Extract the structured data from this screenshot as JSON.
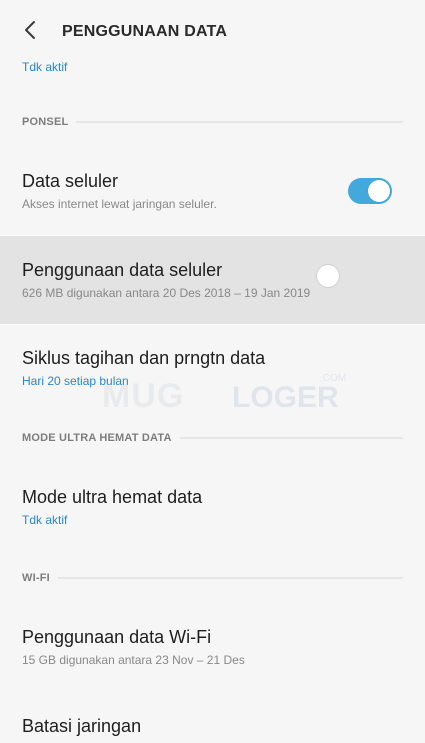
{
  "header": {
    "title": "PENGGUNAAN DATA",
    "back_icon": "chevron-left-icon"
  },
  "top_status": "Tdk aktif",
  "sections": {
    "ponsel": "PONSEL",
    "ultra": "MODE ULTRA HEMAT DATA",
    "wifi": "WI-FI"
  },
  "items": {
    "data_seluler": {
      "title": "Data seluler",
      "subtitle": "Akses internet lewat jaringan seluler.",
      "toggle_on": true
    },
    "penggunaan_seluler": {
      "title": "Penggunaan data seluler",
      "subtitle": "626 MB digunakan antara 20 Des 2018 – 19 Jan 2019"
    },
    "siklus": {
      "title": "Siklus tagihan dan prngtn data",
      "subtitle": "Hari 20 setiap bulan"
    },
    "ultra_hemat": {
      "title": "Mode ultra hemat data",
      "subtitle": "Tdk aktif"
    },
    "wifi_usage": {
      "title": "Penggunaan data Wi-Fi",
      "subtitle": "15 GB digunakan antara 23 Nov – 21 Des"
    },
    "batasi": {
      "title": "Batasi jaringan"
    }
  },
  "watermark": {
    "left": "MUG",
    "right": "LOGER",
    "suffix": ".COM"
  },
  "colors": {
    "accent_blue": "#2a86c9",
    "toggle_blue": "#43a9dc",
    "background": "#f6f6f7",
    "highlight": "#e3e3e4"
  }
}
